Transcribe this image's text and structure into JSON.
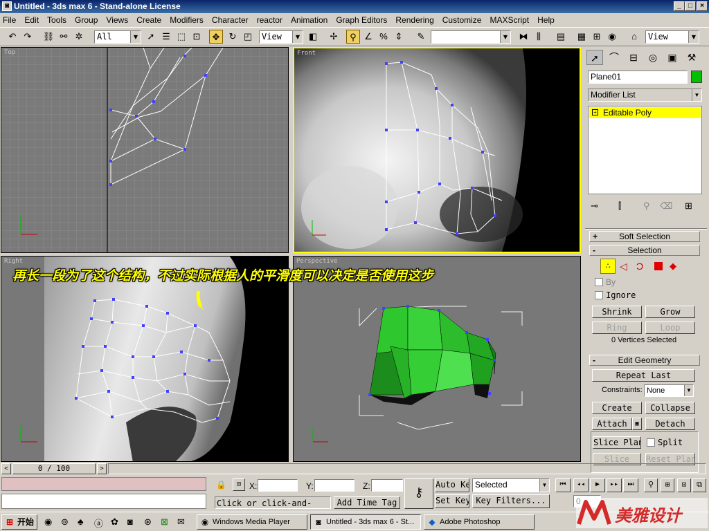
{
  "window": {
    "title": "Untitled - 3ds max 6 - Stand-alone License",
    "controls": [
      "_",
      "□",
      "×"
    ]
  },
  "menu": [
    "File",
    "Edit",
    "Tools",
    "Group",
    "Views",
    "Create",
    "Modifiers",
    "Character",
    "reactor",
    "Animation",
    "Graph Editors",
    "Rendering",
    "Customize",
    "MAXScript",
    "Help"
  ],
  "toolbar": {
    "selection_filter": "All",
    "reference_coord": "View",
    "named_selection": "",
    "right_view": "View"
  },
  "viewports": {
    "top": "Top",
    "front": "Front",
    "right": "Right",
    "perspective": "Perspective"
  },
  "command_panel": {
    "object_name": "Plane01",
    "object_color": "#00c000",
    "modifier_list": "Modifier List",
    "stack_item": "Editable Poly",
    "rollouts": {
      "soft_selection": "Soft Selection",
      "selection": "Selection",
      "edit_geometry": "Edit Geometry"
    },
    "selection": {
      "by": "By",
      "ignore": "Ignore",
      "shrink": "Shrink",
      "grow": "Grow",
      "ring": "Ring",
      "loop": "Loop",
      "status": "0 Vertices Selected"
    },
    "edit_geometry": {
      "repeat_last": "Repeat Last",
      "constraints_label": "Constraints:",
      "constraints_value": "None",
      "create": "Create",
      "collapse": "Collapse",
      "attach": "Attach",
      "detach": "Detach",
      "slice_plane": "Slice Plane",
      "split": "Split",
      "slice": "Slice",
      "reset_plane": "Reset Plane"
    }
  },
  "timeline": {
    "frame": "0 / 100"
  },
  "status": {
    "prompt": "Click or click-and-drag",
    "add_time_tag": "Add Time Tag",
    "x_label": "X:",
    "y_label": "Y:",
    "z_label": "Z:",
    "auto_key": "Auto Key",
    "set_key": "Set Key",
    "selected": "Selected",
    "key_filters": "Key Filters...",
    "frame_field": "0"
  },
  "caption": "再长一段为了这个结构，不过实际根据人的平滑度可以决定是否使用这步",
  "taskbar": {
    "start": "开始",
    "tasks": [
      "Windows Media Player",
      "Untitled - 3ds max 6 - St...",
      "Adobe Photoshop"
    ]
  },
  "watermark": "美雅设计"
}
